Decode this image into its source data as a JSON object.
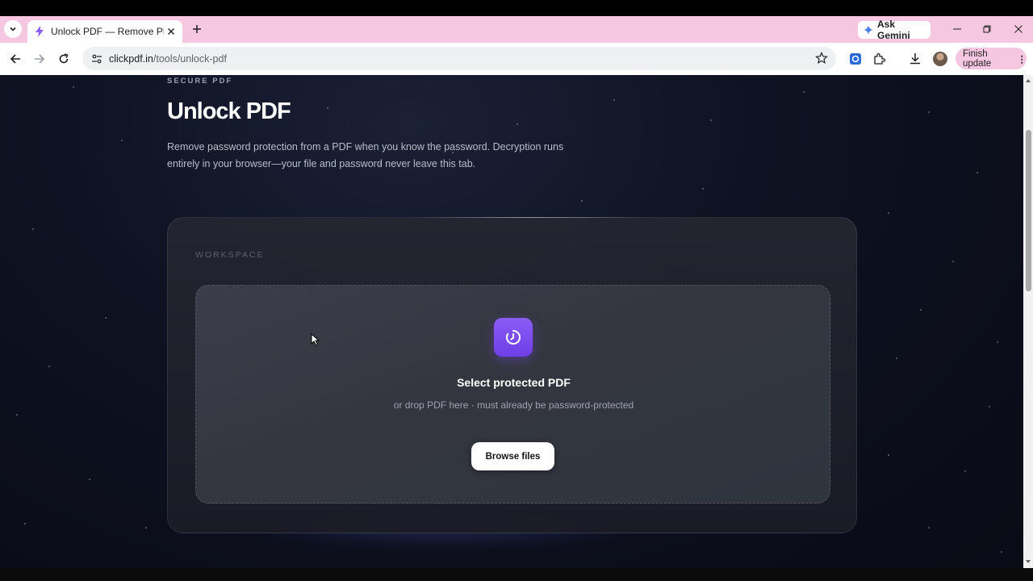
{
  "browser": {
    "tab_title": "Unlock PDF — Remove PDF Pas",
    "ask_gemini": "Ask Gemini",
    "url_domain": "clickpdf.in",
    "url_path": "/tools/unlock-pdf",
    "finish_update": "Finish update"
  },
  "page": {
    "eyebrow": "SECURE PDF",
    "title": "Unlock PDF",
    "description": "Remove password protection from a PDF when you know the password. Decryption runs entirely in your browser—your file and password never leave this tab."
  },
  "workspace": {
    "label": "WORKSPACE",
    "dropzone_title": "Select protected PDF",
    "dropzone_subtitle": "or drop PDF here · must already be password-protected",
    "browse_button": "Browse files"
  },
  "colors": {
    "accent": "#7c4dff",
    "tabstrip": "#f6c7e0",
    "background": "#0e1222"
  }
}
